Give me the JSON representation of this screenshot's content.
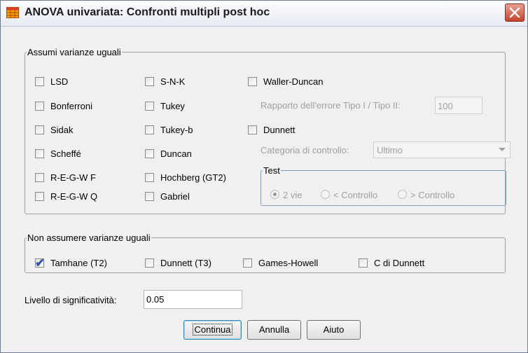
{
  "window": {
    "title": "ANOVA univariata: Confronti multipli post hoc"
  },
  "equal": {
    "legend": "Assumi varianze uguali",
    "col1": [
      "LSD",
      "Bonferroni",
      "Sidak",
      "Scheffé",
      "R-E-G-W F",
      "R-E-G-W Q"
    ],
    "col2": [
      "S-N-K",
      "Tukey",
      "Tukey-b",
      "Duncan",
      "Hochberg (GT2)",
      "Gabriel"
    ],
    "waller": "Waller-Duncan",
    "ratio_label": "Rapporto dell'errore Tipo I / Tipo II:",
    "ratio_value": "100",
    "dunnett": "Dunnett",
    "control_label": "Categoria di controllo:",
    "control_value": "Ultimo",
    "test": {
      "legend": "Test",
      "options": [
        "2 vie",
        "< Controllo",
        "> Controllo"
      ],
      "selected": "2 vie"
    }
  },
  "unequal": {
    "legend": "Non assumere varianze uguali",
    "items": [
      "Tamhane (T2)",
      "Dunnett (T3)",
      "Games-Howell",
      "C di Dunnett"
    ],
    "checked": "Tamhane (T2)"
  },
  "significance": {
    "label": "Livello di significatività:",
    "value": "0.05"
  },
  "buttons": {
    "continue": "Continua",
    "cancel": "Annulla",
    "help": "Aiuto"
  }
}
